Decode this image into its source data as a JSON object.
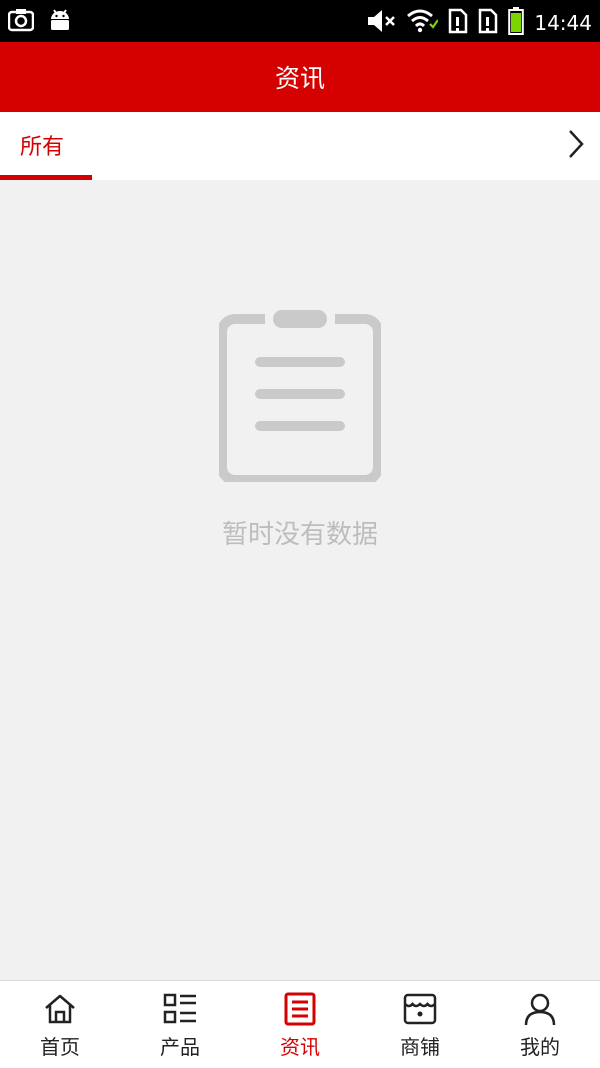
{
  "status_bar": {
    "time": "14:44",
    "left_icons": [
      "screenshot-icon",
      "android-icon"
    ],
    "right_icons": [
      "mute-icon",
      "wifi-icon",
      "sim1-icon",
      "sim2-icon",
      "battery-icon"
    ]
  },
  "header": {
    "title": "资讯"
  },
  "tabs": {
    "items": [
      {
        "label": "所有",
        "active": true
      }
    ],
    "more_icon": "chevron-right-icon"
  },
  "empty_state": {
    "icon": "clipboard-icon",
    "message": "暂时没有数据"
  },
  "bottom_nav": {
    "items": [
      {
        "label": "首页",
        "icon": "home-icon"
      },
      {
        "label": "产品",
        "icon": "list-icon"
      },
      {
        "label": "资讯",
        "icon": "news-icon",
        "active": true
      },
      {
        "label": "商铺",
        "icon": "shop-icon"
      },
      {
        "label": "我的",
        "icon": "profile-icon"
      }
    ]
  },
  "colors": {
    "accent": "#d50000",
    "background": "#f1f1f1",
    "muted": "#bdbdbd"
  }
}
